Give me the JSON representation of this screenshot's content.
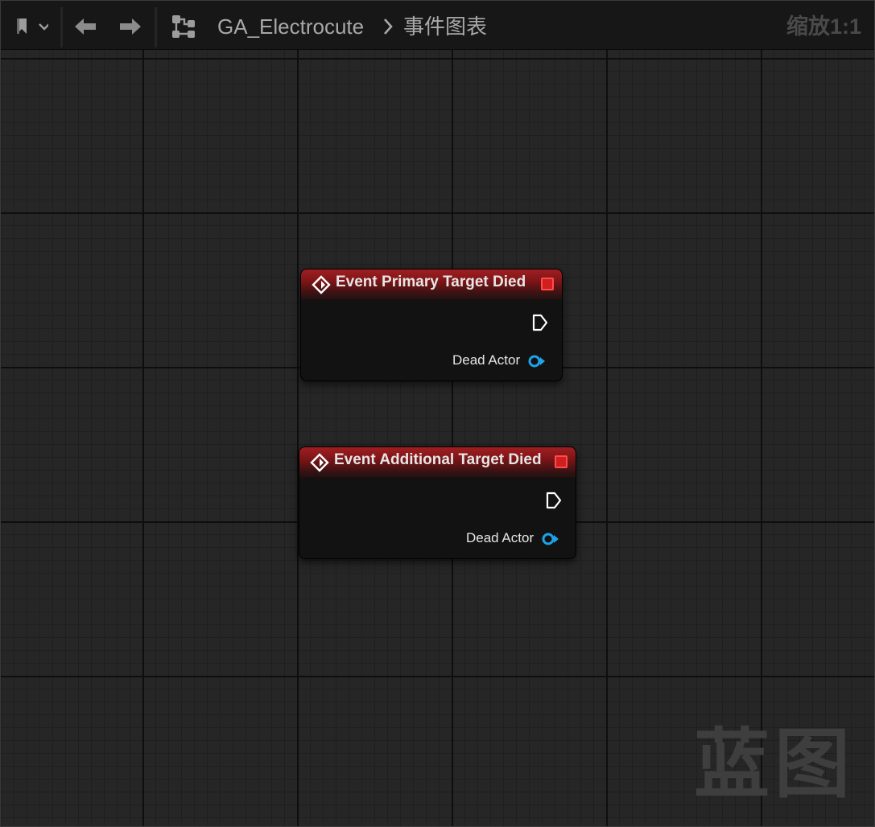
{
  "toolbar": {
    "breadcrumb": {
      "blueprint": "GA_Electrocute",
      "graph": "事件图表"
    },
    "zoom_label": "缩放1:1"
  },
  "nodes": [
    {
      "title": "Event Primary Target Died",
      "pins": {
        "output_label": "Dead Actor"
      }
    },
    {
      "title": "Event Additional Target Died",
      "pins": {
        "output_label": "Dead Actor"
      }
    }
  ],
  "watermark": "蓝图",
  "colors": {
    "event_header": "#a01e21",
    "object_pin": "#1fa2e8",
    "exec_pin": "#ffffff",
    "grid_background": "#262626"
  },
  "icons": {
    "bookmark": "bookmark-icon",
    "back": "arrow-left-icon",
    "forward": "arrow-right-icon",
    "graph": "graph-hierarchy-icon",
    "event": "event-diamond-icon"
  }
}
